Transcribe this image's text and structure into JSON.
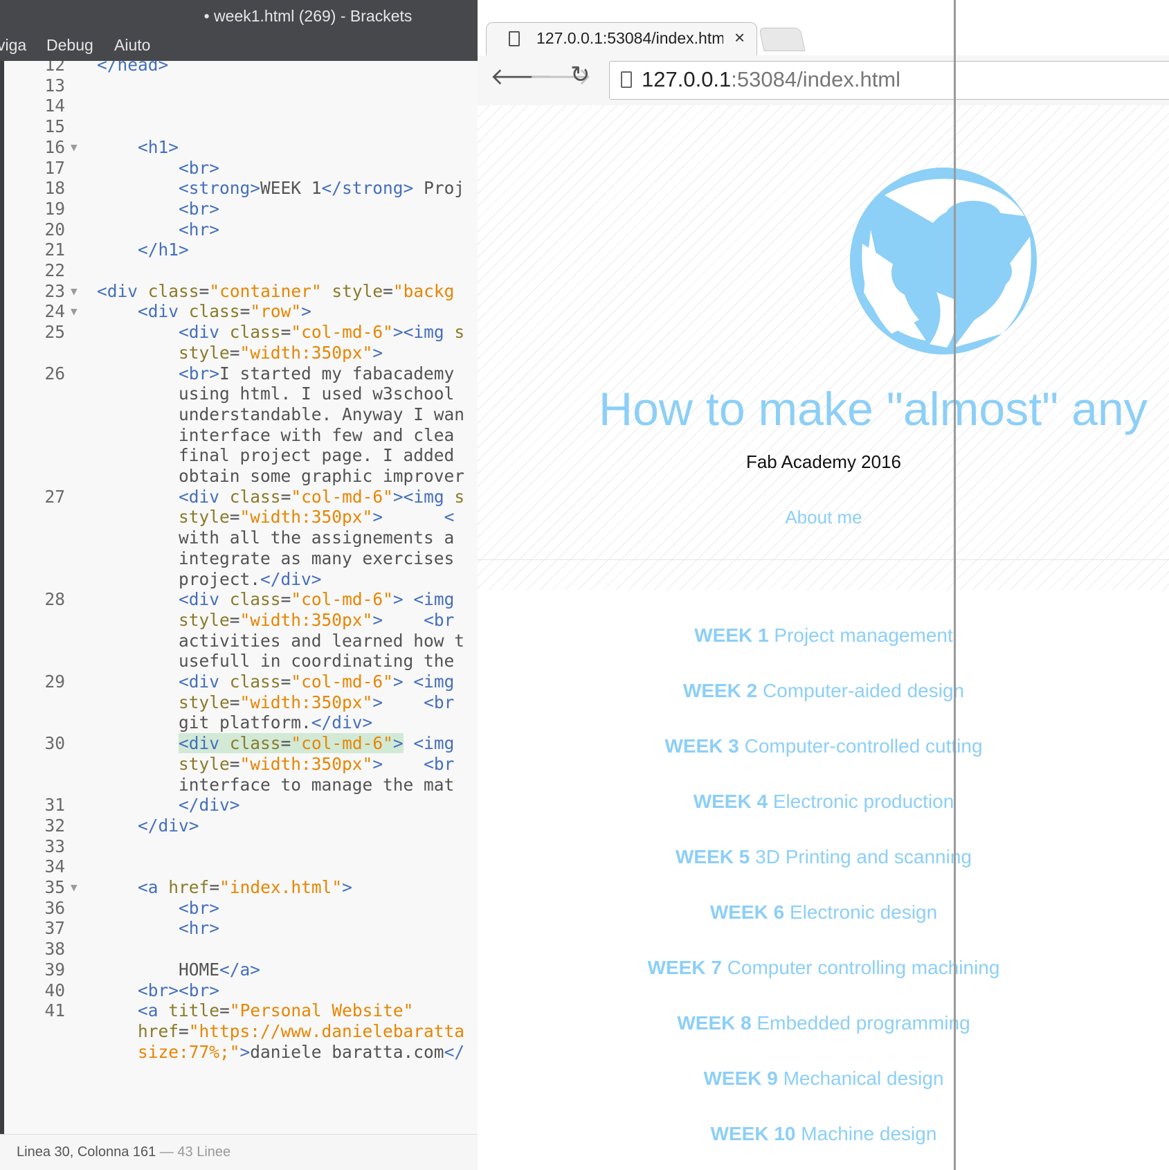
{
  "editor": {
    "title": "• week1.html (269) - Brackets",
    "menu": [
      "viga",
      "Debug",
      "Aiuto"
    ],
    "lines": [
      {
        "n": "12",
        "html": "<span class='tag'>&lt;/head&gt;</span>",
        "indent": 0
      },
      {
        "n": "13",
        "html": ""
      },
      {
        "n": "14",
        "html": ""
      },
      {
        "n": "15",
        "html": ""
      },
      {
        "n": "16",
        "fold": true,
        "html": "    <span class='tag'>&lt;h1&gt;</span>"
      },
      {
        "n": "17",
        "html": "        <span class='tag'>&lt;br&gt;</span>"
      },
      {
        "n": "18",
        "html": "        <span class='tag'>&lt;strong&gt;</span>WEEK 1<span class='tag'>&lt;/strong&gt;</span> Proj"
      },
      {
        "n": "19",
        "html": "        <span class='tag'>&lt;br&gt;</span>"
      },
      {
        "n": "20",
        "html": "        <span class='tag'>&lt;hr&gt;</span>"
      },
      {
        "n": "21",
        "html": "    <span class='tag'>&lt;/h1&gt;</span>"
      },
      {
        "n": "22",
        "html": ""
      },
      {
        "n": "23",
        "fold": true,
        "html": "<span class='tag'>&lt;div</span> <span class='attr'>class</span>=<span class='str'>\"container\"</span> <span class='attr'>style</span>=<span class='str'>\"backg</span>"
      },
      {
        "n": "24",
        "fold": true,
        "html": "    <span class='tag'>&lt;div</span> <span class='attr'>class</span>=<span class='str'>\"row\"</span><span class='tag'>&gt;</span>"
      },
      {
        "n": "25",
        "html": "        <span class='tag'>&lt;div</span> <span class='attr'>class</span>=<span class='str'>\"col-md-6\"</span><span class='tag'>&gt;&lt;img</span> <span class='attr'>s</span>"
      },
      {
        "n": "",
        "html": "        <span class='attr'>style</span>=<span class='str'>\"width:350px\"</span><span class='tag'>&gt;</span>"
      },
      {
        "n": "26",
        "html": "        <span class='tag'>&lt;br&gt;</span>I started my fabacademy"
      },
      {
        "n": "",
        "html": "        using html. I used w3school"
      },
      {
        "n": "",
        "html": "        understandable. Anyway I wan"
      },
      {
        "n": "",
        "html": "        interface with few and clea"
      },
      {
        "n": "",
        "html": "        final project page. I added"
      },
      {
        "n": "",
        "html": "        obtain some graphic improver"
      },
      {
        "n": "27",
        "html": "        <span class='tag'>&lt;div</span> <span class='attr'>class</span>=<span class='str'>\"col-md-6\"</span><span class='tag'>&gt;&lt;img</span> <span class='attr'>s</span>"
      },
      {
        "n": "",
        "html": "        <span class='attr'>style</span>=<span class='str'>\"width:350px\"</span><span class='tag'>&gt;</span>      <span class='tag'>&lt;</span>"
      },
      {
        "n": "",
        "html": "        with all the assignements a"
      },
      {
        "n": "",
        "html": "        integrate as many exercises"
      },
      {
        "n": "",
        "html": "        project.<span class='tag'>&lt;/div&gt;</span>"
      },
      {
        "n": "28",
        "html": "        <span class='tag'>&lt;div</span> <span class='attr'>class</span>=<span class='str'>\"col-md-6\"</span><span class='tag'>&gt;</span> <span class='tag'>&lt;img</span>"
      },
      {
        "n": "",
        "html": "        <span class='attr'>style</span>=<span class='str'>\"width:350px\"</span><span class='tag'>&gt;</span>    <span class='tag'>&lt;br</span>"
      },
      {
        "n": "",
        "html": "        activities and learned how t"
      },
      {
        "n": "",
        "html": "        usefull in coordinating the"
      },
      {
        "n": "29",
        "html": "        <span class='tag'>&lt;div</span> <span class='attr'>class</span>=<span class='str'>\"col-md-6\"</span><span class='tag'>&gt;</span> <span class='tag'>&lt;img</span>"
      },
      {
        "n": "",
        "html": "        <span class='attr'>style</span>=<span class='str'>\"width:350px\"</span><span class='tag'>&gt;</span>    <span class='tag'>&lt;br</span>"
      },
      {
        "n": "",
        "html": "        git platform.<span class='tag'>&lt;/div&gt;</span>"
      },
      {
        "n": "30",
        "html": "        <span class='hl'><span class='tag'>&lt;div</span> <span class='attr'>class</span>=<span class='str'>\"col-md-6\"</span><span class='tag'>&gt;</span></span> <span class='tag'>&lt;img</span>"
      },
      {
        "n": "",
        "html": "        <span class='attr'>style</span>=<span class='str'>\"width:350px\"</span><span class='tag'>&gt;</span>    <span class='tag'>&lt;br</span>"
      },
      {
        "n": "",
        "html": "        interface to manage the mat"
      },
      {
        "n": "31",
        "html": "        <span class='tag'>&lt;/div&gt;</span>"
      },
      {
        "n": "32",
        "html": "    <span class='tag'>&lt;/div&gt;</span>"
      },
      {
        "n": "33",
        "html": ""
      },
      {
        "n": "34",
        "html": ""
      },
      {
        "n": "35",
        "fold": true,
        "html": "    <span class='tag'>&lt;a</span> <span class='attr'>href</span>=<span class='str'>\"index.html\"</span><span class='tag'>&gt;</span>"
      },
      {
        "n": "36",
        "html": "        <span class='tag'>&lt;br&gt;</span>"
      },
      {
        "n": "37",
        "html": "        <span class='tag'>&lt;hr&gt;</span>"
      },
      {
        "n": "38",
        "html": ""
      },
      {
        "n": "39",
        "html": "        HOME<span class='tag'>&lt;/a&gt;</span>"
      },
      {
        "n": "40",
        "html": "    <span class='tag'>&lt;br&gt;&lt;br&gt;</span>"
      },
      {
        "n": "41",
        "html": "    <span class='tag'>&lt;a</span> <span class='attr'>title</span>=<span class='str'>\"Personal Website\"</span>"
      },
      {
        "n": "",
        "html": "    <span class='attr'>href</span>=<span class='str'>\"https://www.danielebaratta</span>"
      },
      {
        "n": "",
        "html": "    <span class='str'>size:77%;\"</span><span class='tag'>&gt;</span>daniele baratta.com<span class='tag'>&lt;/</span>"
      }
    ],
    "status": {
      "position": "Linea 30, Colonna 161",
      "lines": " — 43 Linee"
    }
  },
  "browser": {
    "tab_title": "127.0.0.1:53084/index.htm",
    "tab_close": "×",
    "url_host": "127.0.0.1",
    "url_rest": ":53084/index.html",
    "back": "🡐",
    "forward": "🡒",
    "reload": "↻"
  },
  "site": {
    "title": "How to make \"almost\" any",
    "subtitle": "Fab Academy 2016",
    "about": "About me",
    "accent": "#8ccff7",
    "weeks": [
      {
        "label": "WEEK 1",
        "name": "Project management"
      },
      {
        "label": "WEEK 2",
        "name": "Computer-aided design"
      },
      {
        "label": "WEEK 3",
        "name": "Computer-controlled cutting"
      },
      {
        "label": "WEEK 4",
        "name": "Electronic production"
      },
      {
        "label": "WEEK 5",
        "name": "3D Printing and scanning"
      },
      {
        "label": "WEEK 6",
        "name": "Electronic design"
      },
      {
        "label": "WEEK 7",
        "name": "Computer controlling machining"
      },
      {
        "label": "WEEK 8",
        "name": "Embedded programming"
      },
      {
        "label": "WEEK 9",
        "name": "Mechanical design"
      },
      {
        "label": "WEEK 10",
        "name": "Machine design"
      }
    ]
  }
}
